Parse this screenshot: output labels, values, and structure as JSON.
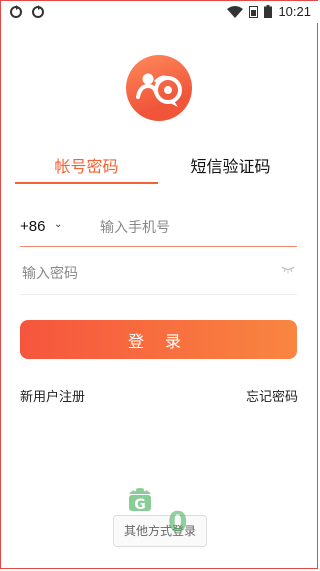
{
  "status_bar": {
    "time": "10:21",
    "icons": [
      "refresh-icon",
      "refresh-icon",
      "wifi-icon",
      "sim-icon",
      "battery-icon"
    ]
  },
  "app": {
    "logo_icon": "chat-people-icon"
  },
  "tabs": [
    {
      "label": "帐号密码",
      "active": true
    },
    {
      "label": "短信验证码",
      "active": false
    }
  ],
  "form": {
    "country_code": "+86",
    "phone_placeholder": "输入手机号",
    "password_placeholder": "输入密码",
    "login_label": "登 录"
  },
  "links": {
    "register": "新用户注册",
    "forgot_password": "忘记密码"
  },
  "footer": {
    "other_login": "其他方式登录",
    "watermark": "0"
  },
  "colors": {
    "accent": "#f46235",
    "button_start": "#f6553d",
    "button_end": "#f98640"
  }
}
